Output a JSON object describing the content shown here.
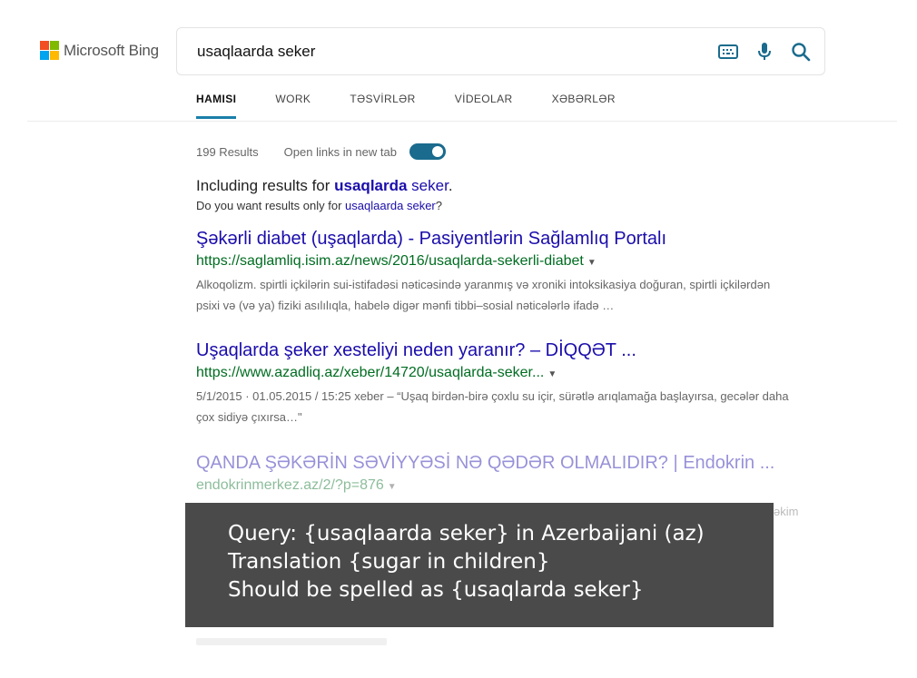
{
  "logo": {
    "text": "Microsoft Bing",
    "colors": [
      "#f25022",
      "#7fba00",
      "#00a4ef",
      "#ffb900"
    ]
  },
  "search": {
    "query": "usaqlaarda seker",
    "icons": [
      "keyboard-icon",
      "microphone-icon",
      "search-icon"
    ]
  },
  "tabs": [
    {
      "label": "HAMISI",
      "active": true
    },
    {
      "label": "WORK",
      "active": false
    },
    {
      "label": "TƏSVİRLƏR",
      "active": false
    },
    {
      "label": "VİDEOLAR",
      "active": false
    },
    {
      "label": "XƏBƏRLƏR",
      "active": false
    }
  ],
  "meta": {
    "count": "199 Results",
    "toggle_label": "Open links in new tab",
    "toggle_on": true
  },
  "spell": {
    "including_prefix": "Including results for ",
    "including_bold": "usaqlarda",
    "including_rest": " seker",
    "including_end": ".",
    "didyou_prefix": "Do you want results only for ",
    "didyou_link": "usaqlaarda seker",
    "didyou_end": "?"
  },
  "results": [
    {
      "title": "Şəkərli diabet (uşaqlarda) - Pasiyentlərin Sağlamlıq Portalı",
      "url": "https://saglamliq.isim.az/news/2016/usaqlarda-sekerli-diabet",
      "snippet": "Alkoqolizm. spirtli içkilərin sui-istifadəsi nəticəsində yaranmış və xroniki intoksikasiya doğuran, spirtli içkilərdən psixi və (və ya) fiziki asılılıqla, habelə digər mənfi tibbi–sosial nəticələrlə ifadə …"
    },
    {
      "title": "Uşaqlarda şeker xesteliyi neden yaranır? – DİQQƏT ...",
      "url": "https://www.azadliq.az/xeber/14720/usaqlarda-seker...",
      "snippet": "5/1/2015 · 01.05.2015 / 15:25 xeber – “Uşaq birdən-birə çoxlu su içir, sürətlə arıqlamağa başlayırsa, gecələr daha çox sidiyə çıxırsa…\""
    },
    {
      "title": "QANDA ŞƏKƏRİN SƏVİYYƏSİ NƏ QƏDƏR OLMALIDIR? | Endokrin ...",
      "url": "endokrinmerkez.az/2/?p=876"
    }
  ],
  "ghost_text": {
    "right": "əkim"
  },
  "overlay": {
    "line1": "Query: {usaqlaarda seker} in Azerbaijani (az)",
    "line2": "Translation {sugar in children}",
    "line3": "Should be spelled as {usaqlarda seker}"
  }
}
